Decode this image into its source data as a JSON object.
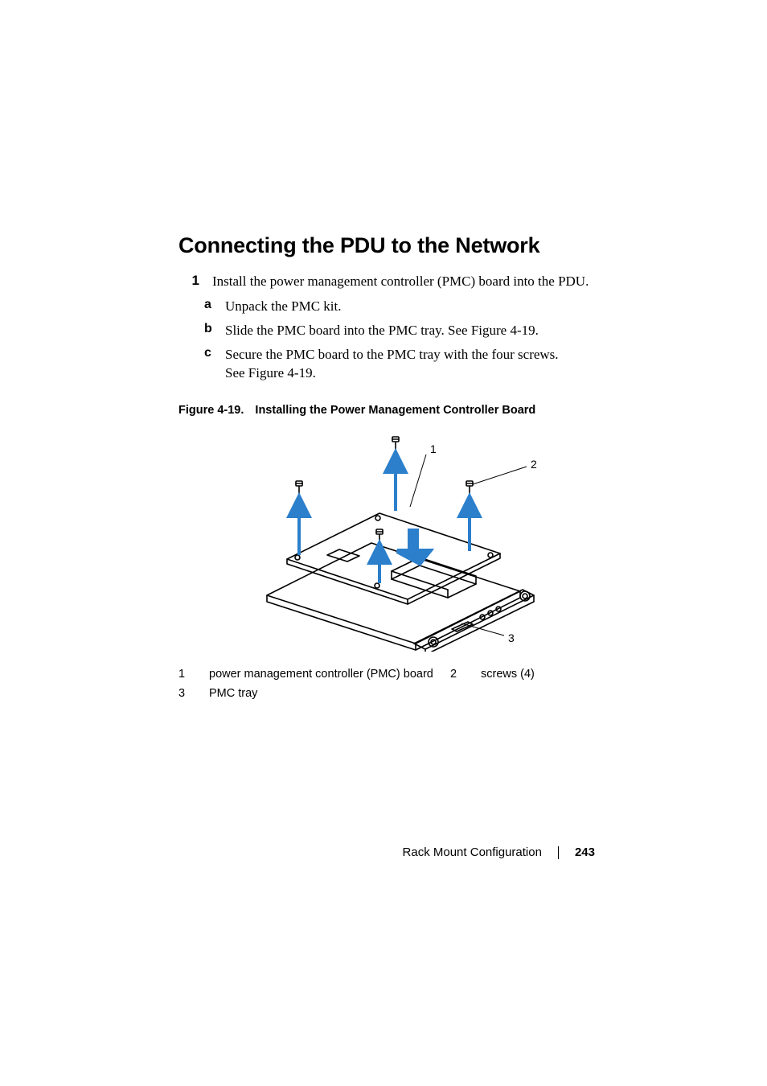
{
  "heading": "Connecting the PDU to the Network",
  "step": {
    "num": "1",
    "text": "Install the power management controller (PMC) board into the PDU.",
    "subs": [
      {
        "marker": "a",
        "text": "Unpack the PMC kit."
      },
      {
        "marker": "b",
        "text": "Slide the PMC board into the PMC tray. See Figure 4-19."
      },
      {
        "marker": "c",
        "text": "Secure the PMC board to the PMC tray with the four screws. See Figure 4-19."
      }
    ]
  },
  "figure": {
    "label": "Figure 4-19.",
    "title": "Installing the Power Management Controller Board",
    "callouts": {
      "c1": "1",
      "c2": "2",
      "c3": "3"
    }
  },
  "legend": [
    {
      "idx": "1",
      "text": "power management controller (PMC) board"
    },
    {
      "idx": "2",
      "text": "screws (4)"
    },
    {
      "idx": "3",
      "text": "PMC tray"
    }
  ],
  "footer": {
    "section": "Rack Mount Configuration",
    "page": "243"
  }
}
